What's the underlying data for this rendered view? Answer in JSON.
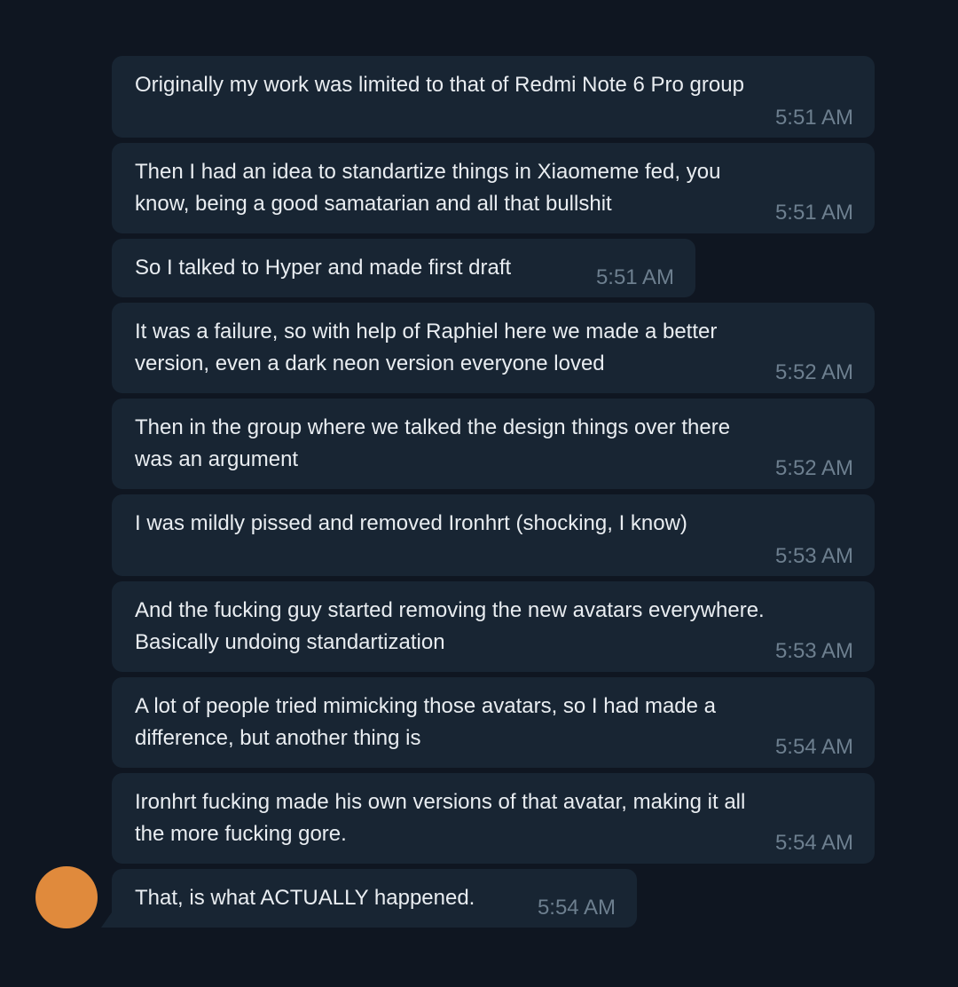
{
  "colors": {
    "background": "#0f1621",
    "bubble": "#182533",
    "text": "#e9edf1",
    "time": "#6d7f8f",
    "avatar": "#e08a3c"
  },
  "messages": [
    {
      "text": "Originally my work was limited to that of Redmi Note 6 Pro group",
      "time": "5:51 AM"
    },
    {
      "text": "Then I had an idea to standartize things in Xiaomeme fed, you\nknow, being a good samatarian and all that bullshit",
      "time": "5:51 AM"
    },
    {
      "text": "So I talked to Hyper and made first draft",
      "time": "5:51 AM"
    },
    {
      "text": "It was a failure, so with help of Raphiel here we made a better\nversion, even a dark neon version everyone loved",
      "time": "5:52 AM"
    },
    {
      "text": "Then in the group where we talked the design things over there\nwas an argument",
      "time": "5:52 AM"
    },
    {
      "text": "I was mildly pissed and removed Ironhrt (shocking, I know)",
      "time": "5:53 AM"
    },
    {
      "text": "And the fucking guy started removing the new avatars everywhere.\nBasically undoing standartization",
      "time": "5:53 AM"
    },
    {
      "text": "A lot of people tried mimicking those avatars, so I had made a\ndifference, but another thing is",
      "time": "5:54 AM"
    },
    {
      "text": "Ironhrt fucking made his own versions of that avatar, making it all\nthe more fucking gore.",
      "time": "5:54 AM"
    },
    {
      "text": "That, is what ACTUALLY happened.",
      "time": "5:54 AM"
    }
  ]
}
